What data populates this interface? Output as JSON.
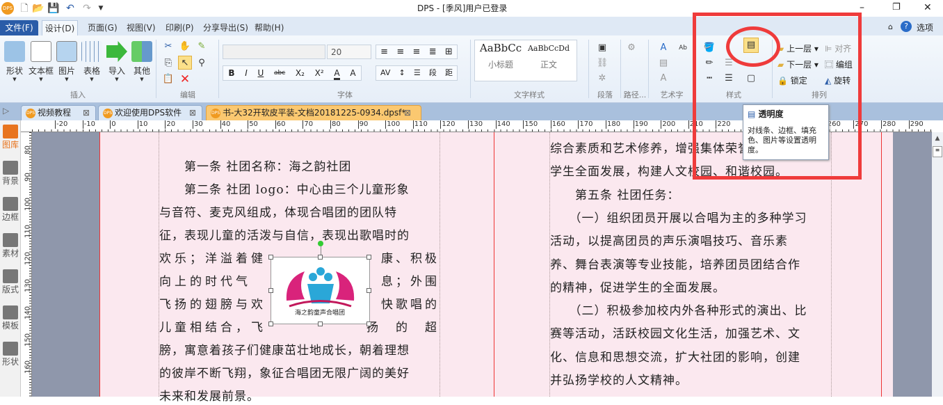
{
  "window": {
    "app_title": "DPS - [季风]用户已登录",
    "minimize": "–",
    "restore": "❐",
    "close": "✕"
  },
  "quick_access": [
    "new",
    "open",
    "save",
    "undo",
    "redo",
    "more"
  ],
  "menu": {
    "file": "文件(F)",
    "tabs": [
      "设计(D)",
      "页面(G)",
      "视图(V)",
      "印刷(P)",
      "分享导出(S)",
      "帮助(H)"
    ],
    "options": "选项"
  },
  "ribbon": {
    "insert": {
      "buttons": [
        "形状",
        "文本框",
        "图片",
        "表格",
        "导入",
        "其他"
      ],
      "label": "插入"
    },
    "edit": {
      "label": "编辑"
    },
    "font": {
      "font_name": "",
      "font_size": "20",
      "label": "字体",
      "format_buttons": [
        "B",
        "I",
        "U",
        "abc",
        "X₂",
        "X²",
        "A",
        "A"
      ],
      "para_buttons": [
        "段",
        "距"
      ]
    },
    "text_style": {
      "styles": [
        {
          "sample": "AaBbCc",
          "name": "小标题"
        },
        {
          "sample": "AaBbCcDd",
          "name": "正文"
        }
      ],
      "label": "文字样式"
    },
    "paragraph": {
      "label": "段落"
    },
    "path": {
      "label": "路径..."
    },
    "art_text": {
      "label": "艺术字"
    },
    "style": {
      "label": "样式"
    },
    "arrange": {
      "label": "排列",
      "buttons": [
        "上一层",
        "下一层",
        "锁定",
        "对齐",
        "编组",
        "旋转"
      ]
    }
  },
  "doc_tabs": [
    {
      "label": "视频教程"
    },
    {
      "label": "欢迎使用DPS软件"
    },
    {
      "label": "书-大32开软皮平装-文档20181225-0934.dpsf*",
      "active": true
    }
  ],
  "ruler": {
    "h": [
      "-20",
      "-10",
      "0",
      "10",
      "20",
      "30",
      "40",
      "50",
      "60",
      "70",
      "80",
      "90",
      "100",
      "110",
      "120",
      "130",
      "140",
      "150",
      "160",
      "170",
      "180",
      "190",
      "200",
      "210",
      "220",
      "230",
      "240",
      "250",
      "260",
      "270",
      "280",
      "290"
    ],
    "v": [
      "80",
      "90",
      "100",
      "110",
      "120",
      "130",
      "140",
      "150",
      "160"
    ]
  },
  "sidebar": [
    "图库",
    "背景",
    "边框",
    "素材",
    "版式",
    "模板",
    "形状"
  ],
  "tooltip": {
    "title": "透明度",
    "body": "对线条、边框、填充色、图片等设置透明度。"
  },
  "image": {
    "logo_text": "海之韵童声合唱团"
  },
  "left_column": [
    {
      "t": "　　第一条 社团名称：海之韵社团"
    },
    {
      "t": "　　第二条 社团 logo：中心由三个儿童形象"
    },
    {
      "t": "与音符、麦克风组成，体现合唱团的团队特"
    },
    {
      "t": "征，表现儿童的活泼与自信，表现出歌唱时的"
    },
    {
      "a": "欢乐；洋溢着健",
      "b": "康、积极"
    },
    {
      "a": "向上的时代气",
      "b": "息；外围"
    },
    {
      "a": "飞扬的翅膀与欢",
      "b": "快歌唱的"
    },
    {
      "a": "儿童相结合，飞",
      "b": "扬　的　超"
    },
    {
      "t": "膀，寓意着孩子们健康茁壮地成长，朝着理想"
    },
    {
      "t": "的彼岸不断飞翔，象征合唱团无限广阔的美好"
    },
    {
      "t": "未来和发展前景。"
    }
  ],
  "right_column": [
    "综合素质和艺术修养，增强集体荣誉感，促进",
    "学生全面发展，构建人文校园、和谐校园。",
    "　　第五条 社团任务：",
    "　　（一）组织团员开展以合唱为主的多种学习",
    "活动，以提高团员的声乐演唱技巧、音乐素",
    "养、舞台表演等专业技能，培养团员团结合作",
    "的精神，促进学生的全面发展。",
    "　　（二）积极参加校内外各种形式的演出、比",
    "赛等活动，活跃校园文化生活，加强艺术、文",
    "化、信息和思想交流，扩大社团的影响，创建",
    "并弘扬学校的人文精神。"
  ]
}
